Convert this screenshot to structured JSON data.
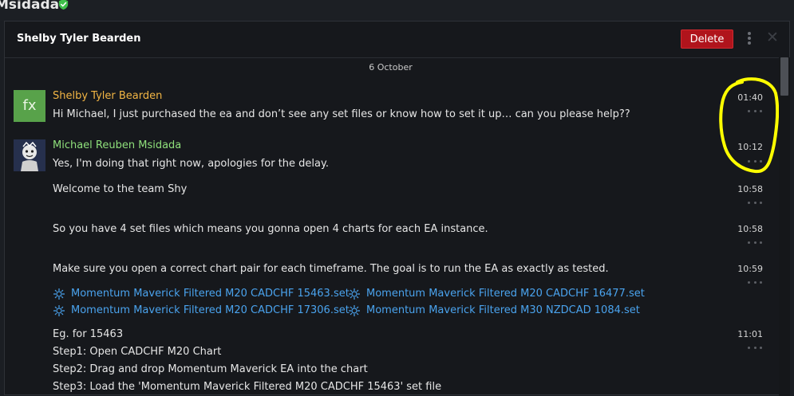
{
  "top": {
    "title": "Msidada"
  },
  "header": {
    "title": "Shelby Tyler Bearden",
    "delete_label": "Delete",
    "close_glyph": "✕"
  },
  "date_separator": "6 October",
  "messages": [
    {
      "sender": "Shelby Tyler Bearden",
      "avatar_text": "fx",
      "text": "Hi Michael, I just purchased the ea and don’t see any set files or know how to set it up… can you please help??",
      "time": "01:40"
    },
    {
      "sender": "Michael Reuben Msidada",
      "text": "Yes, I'm doing that right now, apologies for the delay.",
      "time": "10:12"
    },
    {
      "text": "Welcome to the team Shy",
      "time": "10:58"
    },
    {
      "text": "So you have 4 set files which means you gonna open 4 charts for each EA instance.",
      "time": "10:58"
    },
    {
      "text": "Make sure you open a correct chart pair for each timeframe. The goal is to run the EA as exactly as tested.",
      "time": "10:59"
    }
  ],
  "files": [
    "Momentum Maverick Filtered M20 CADCHF 15463.set",
    "Momentum Maverick Filtered M20 CADCHF 16477.set",
    "Momentum Maverick Filtered M20 CADCHF 17306.set",
    "Momentum Maverick Filtered M30 NZDCAD 1084.set"
  ],
  "steps": {
    "lines": [
      "Eg. for 15463",
      "Step1: Open CADCHF M20 Chart",
      "Step2: Drag and drop Momentum Maverick EA into the chart",
      "Step3: Load the 'Momentum Maverick Filtered M20 CADCHF 15463' set file"
    ],
    "time": "11:01"
  },
  "colors": {
    "sender_shelby": "#f2b544",
    "sender_michael": "#8fe07b",
    "link": "#4aa3ee",
    "delete_bg": "#b0141c",
    "verified": "#3fbf4a",
    "annotation": "#ffff00"
  },
  "icons": [
    "verified-check-icon",
    "more-vertical-icon",
    "close-icon",
    "file-set-icon"
  ]
}
